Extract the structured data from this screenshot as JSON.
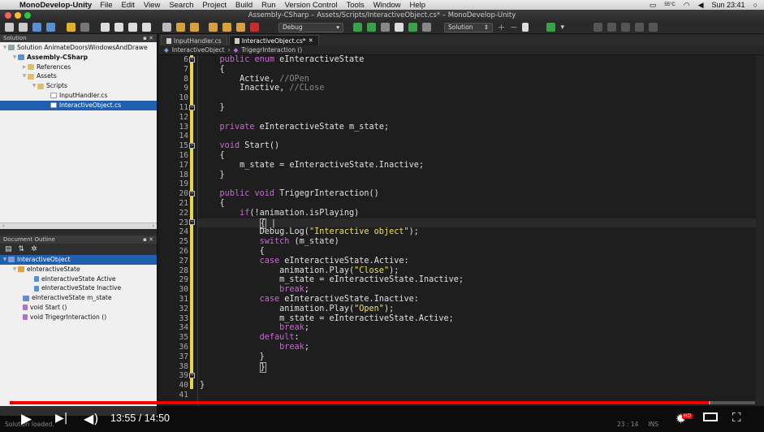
{
  "menubar": {
    "app": "MonoDevelop-Unity",
    "items": [
      "File",
      "Edit",
      "View",
      "Search",
      "Project",
      "Build",
      "Run",
      "Version Control",
      "Tools",
      "Window",
      "Help"
    ],
    "clock": "Sun 23:41",
    "temp": "55°C"
  },
  "window": {
    "title": "Assembly-CSharp – Assets/Scripts/InteractiveObject.cs* – MonoDevelop-Unity"
  },
  "toolbar": {
    "config": "Debug",
    "target": "Solution"
  },
  "solution_pad": {
    "title": "Solution",
    "items": [
      {
        "label": "Solution AnimateDoorsWindowsAndDrawe",
        "indent": 0
      },
      {
        "label": "Assembly-CSharp",
        "indent": 1
      },
      {
        "label": "References",
        "indent": 2
      },
      {
        "label": "Assets",
        "indent": 2
      },
      {
        "label": "Scripts",
        "indent": 3
      },
      {
        "label": "InputHandler.cs",
        "indent": 4
      },
      {
        "label": "InteractiveObject.cs",
        "indent": 4
      }
    ]
  },
  "outline_pad": {
    "title": "Document Outline",
    "items": [
      {
        "label": "InteractiveObject"
      },
      {
        "label": "eInteractiveState"
      },
      {
        "label": "eInteractiveState Active"
      },
      {
        "label": "eInteractiveState Inactive"
      },
      {
        "label": "eInteractiveState m_state"
      },
      {
        "label": "void Start ()"
      },
      {
        "label": "void TrigegrInteraction ()"
      }
    ]
  },
  "tabs": [
    {
      "label": "InputHandler.cs"
    },
    {
      "label": "InteractiveObject.cs*"
    }
  ],
  "breadcrumbs": {
    "class": "InteractiveObject",
    "member": "TrigegrInteraction ()"
  },
  "code": {
    "line_numbers": [
      "6",
      "7",
      "8",
      "9",
      "10",
      "11",
      "12",
      "13",
      "14",
      "15",
      "16",
      "17",
      "18",
      "19",
      "20",
      "21",
      "22",
      "23",
      "24",
      "25",
      "26",
      "27",
      "28",
      "29",
      "30",
      "31",
      "32",
      "33",
      "34",
      "35",
      "36",
      "37",
      "38",
      "39",
      "40",
      "41"
    ]
  },
  "status": {
    "message": "Solution loaded.",
    "position": "23 : 14",
    "mode": "INS"
  },
  "video": {
    "time": "13:55 / 14:50",
    "progress": 0.938,
    "buffered": 0.94
  },
  "colors": {
    "accent": "#1f5fae",
    "progress": "#e00000",
    "keyword": "#c76bd0",
    "string": "#f0e05a"
  }
}
